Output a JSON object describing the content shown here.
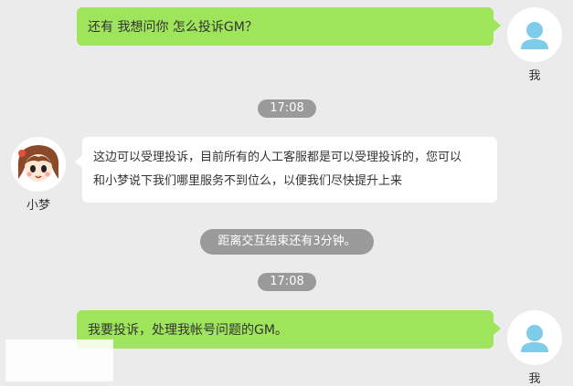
{
  "messages": [
    {
      "id": "m1",
      "text": "还有 我想问你 怎么投诉GM？"
    },
    {
      "id": "m2",
      "text_line1": "这边可以受理投诉，目前所有的人工客服都是可以受理投诉的，您可以",
      "text_line2": "和小梦说下我们哪里服务不到位么，以便我们尽快提升上来"
    },
    {
      "id": "m3",
      "text": "我要投诉，处理我帐号问题的GM。"
    }
  ],
  "user": {
    "name": "我",
    "avatar_icon": "user-silhouette-icon",
    "avatar_color": "#7ecbea"
  },
  "agent": {
    "name": "小梦",
    "avatar_icon": "cartoon-girl-avatar-icon"
  },
  "timestamps": [
    "17:08",
    "17:08"
  ],
  "notice": "距离交互结束还有3分钟。",
  "colors": {
    "background": "#ebebeb",
    "user_bubble": "#9ee55b",
    "agent_bubble": "#ffffff",
    "pill": "#9a9a9a"
  }
}
